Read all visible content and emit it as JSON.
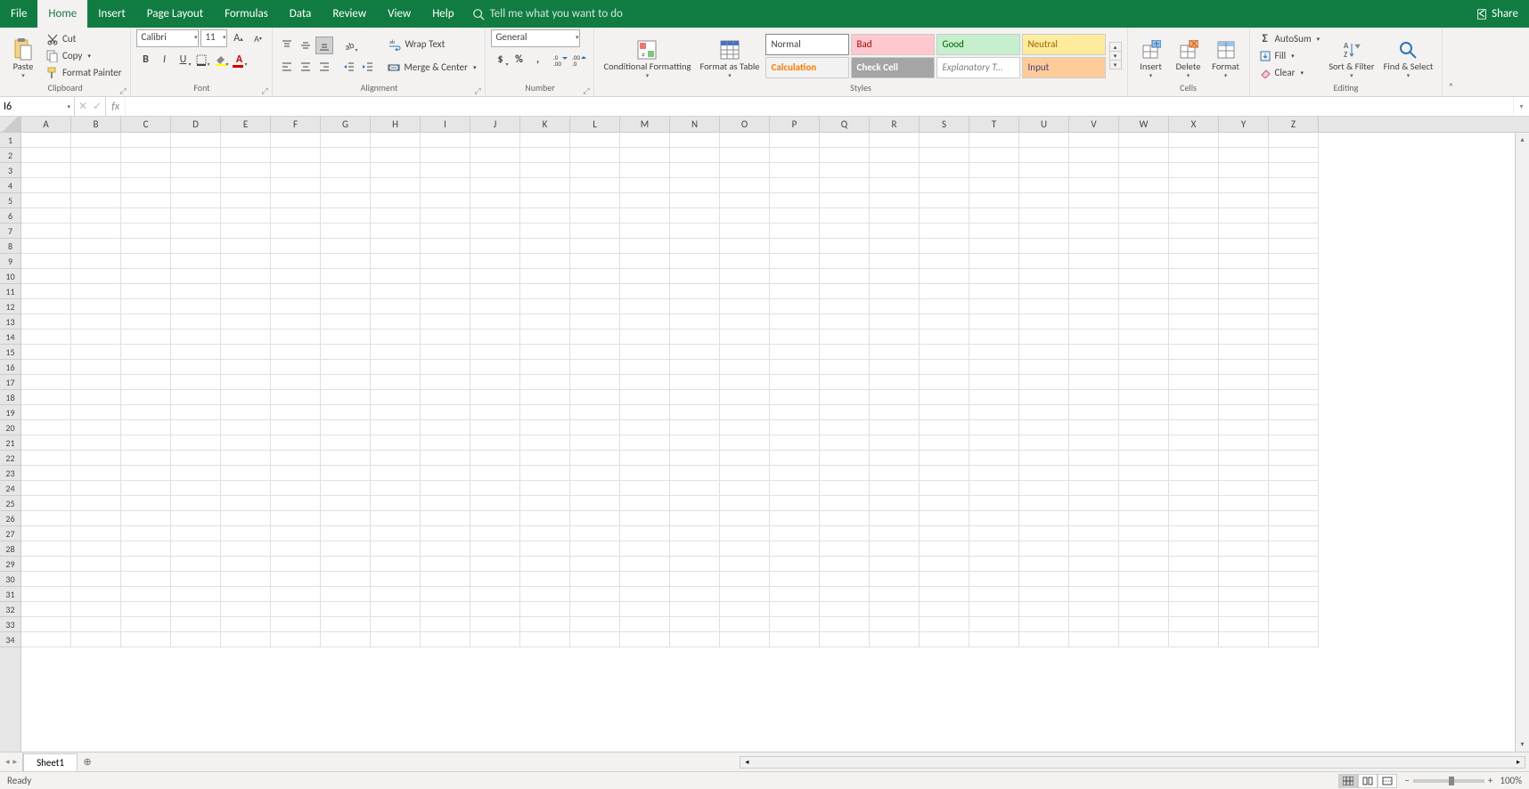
{
  "tabs": [
    "File",
    "Home",
    "Insert",
    "Page Layout",
    "Formulas",
    "Data",
    "Review",
    "View",
    "Help"
  ],
  "active_tab": "Home",
  "tellme_placeholder": "Tell me what you want to do",
  "share_label": "Share",
  "clipboard": {
    "paste": "Paste",
    "cut": "Cut",
    "copy": "Copy",
    "format_painter": "Format Painter",
    "group_label": "Clipboard"
  },
  "font": {
    "name": "Calibri",
    "size": "11",
    "group_label": "Font"
  },
  "alignment": {
    "wrap": "Wrap Text",
    "merge": "Merge & Center",
    "group_label": "Alignment"
  },
  "number": {
    "format": "General",
    "group_label": "Number"
  },
  "styles": {
    "cond_fmt": "Conditional Formatting",
    "fmt_table": "Format as Table",
    "cells": [
      "Normal",
      "Bad",
      "Good",
      "Neutral",
      "Calculation",
      "Check Cell",
      "Explanatory T...",
      "Input"
    ],
    "group_label": "Styles"
  },
  "cells_group": {
    "insert": "Insert",
    "delete": "Delete",
    "format": "Format",
    "group_label": "Cells"
  },
  "editing": {
    "autosum": "AutoSum",
    "fill": "Fill",
    "clear": "Clear",
    "sort": "Sort & Filter",
    "find": "Find & Select",
    "group_label": "Editing"
  },
  "namebox_value": "I6",
  "fx_label": "fx",
  "columns": [
    "A",
    "B",
    "C",
    "D",
    "E",
    "F",
    "G",
    "H",
    "I",
    "J",
    "K",
    "L",
    "M",
    "N",
    "O",
    "P",
    "Q",
    "R",
    "S",
    "T",
    "U",
    "V",
    "W",
    "X",
    "Y",
    "Z"
  ],
  "row_count": 34,
  "sheet_name": "Sheet1",
  "status_text": "Ready",
  "zoom_label": "100%"
}
